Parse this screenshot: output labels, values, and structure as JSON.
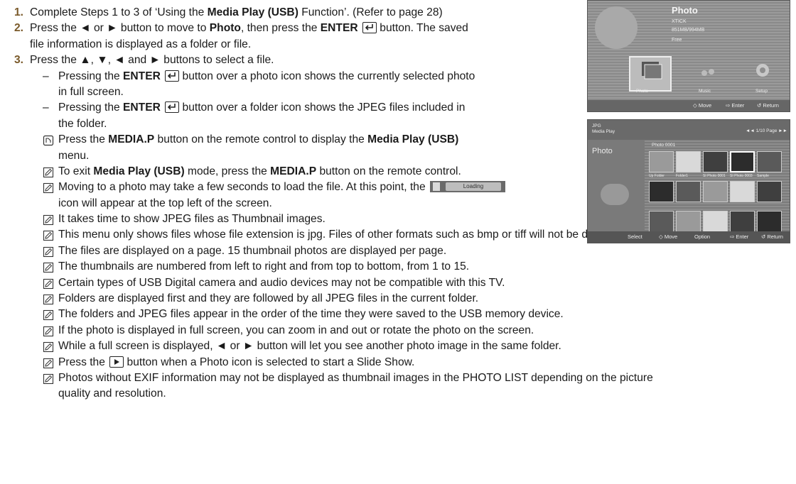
{
  "steps": [
    {
      "num": "1.",
      "parts": [
        "Complete Steps 1 to 3 of ‘Using the ",
        "Media Play (USB)",
        " Function’. (Refer to page 28)"
      ]
    },
    {
      "num": "2.",
      "line1": [
        "Press the ◄ or ► button to move to ",
        "Photo",
        ", then press the ",
        "ENTER",
        " button. The saved"
      ],
      "line2": "file information is displayed as a folder or file."
    },
    {
      "num": "3.",
      "text": "Press the ▲, ▼, ◄ and ► buttons to select a file."
    }
  ],
  "sub_items": [
    {
      "dash": "–",
      "line1": [
        "Pressing the ",
        "ENTER",
        " button over a photo icon shows the currently selected photo"
      ],
      "line2": "in full screen."
    },
    {
      "dash": "–",
      "line1": [
        "Pressing the ",
        "ENTER",
        " button over a folder icon shows the JPEG files included in"
      ],
      "line2": "the folder."
    }
  ],
  "media_note": {
    "line1": [
      "Press the ",
      "MEDIA.P",
      " button on the remote control to display the ",
      "Media Play (USB)"
    ],
    "line2": "menu."
  },
  "exit_note": [
    "To exit ",
    "Media Play (USB)",
    " mode, press the ",
    "MEDIA.P",
    " button on the remote control."
  ],
  "loading_note": {
    "line1": "Moving to a photo may take a few seconds to load the file. At this point, the",
    "badge": "Loading",
    "line2": "icon will appear at the top left of the screen."
  },
  "notes": [
    "It takes time to show JPEG files as Thumbnail images.",
    "This menu only shows files whose file extension is jpg. Files of other formats such as bmp or tiff will not be displayed.",
    "The files are displayed on a page. 15 thumbnail photos are displayed per page.",
    "The thumbnails are numbered from left to right and from top to bottom, from 1 to 15.",
    "Certain types of USB Digital camera and audio devices may not be compatible with this TV.",
    "Folders are displayed first and they are followed by all JPEG files in the current folder.",
    "The folders and JPEG files appear in the order of the time they were saved to the USB memory device.",
    "If the photo is displayed in full screen, you can zoom in and out or rotate the photo on the screen.",
    "While a full screen is displayed, ◄ or ► button will let you see another photo image in the same folder."
  ],
  "slideshow_note": [
    "Press the ",
    " button when a Photo icon is selected to start a Slide Show."
  ],
  "exif_note": {
    "line1": "Photos without EXIF information may not be displayed as thumbnail images in the PHOTO LIST depending on the picture",
    "line2": "quality and resolution."
  },
  "screenshot1": {
    "title": "Photo",
    "info": [
      "XTICK",
      "851MB/994MB",
      "Free"
    ],
    "tiles": [
      "Photo",
      "Music",
      "Setup"
    ],
    "footer": [
      "◇ Move",
      "⇨ Enter",
      "↺ Return"
    ]
  },
  "screenshot2": {
    "header_left": [
      "JPG",
      "Media Play"
    ],
    "page": "◄◄ 1/10 Page ►►",
    "heading": "Photo",
    "folder_tab": "Photo 0001",
    "footer": [
      "Select",
      "◇ Move",
      "Option",
      "⇨ Enter",
      "↺ Return"
    ],
    "row1_labels": [
      "Up Folder",
      "Folder1",
      "SI Photo 0001",
      "SI Photo 0003",
      "Sample"
    ]
  },
  "colors": {
    "step_number": "#7a5a2a",
    "text": "#1a1a1a"
  }
}
